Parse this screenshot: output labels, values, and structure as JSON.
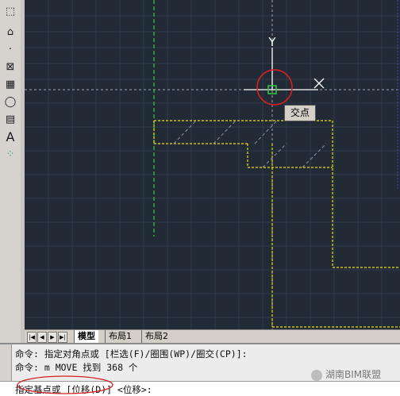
{
  "toolbar": {
    "tools": [
      {
        "icon": "select-icon",
        "glyph": "⬚"
      },
      {
        "icon": "region-icon",
        "glyph": "⌂"
      },
      {
        "icon": "dot-icon",
        "glyph": "·"
      },
      {
        "icon": "hatch-icon",
        "glyph": "⊠"
      },
      {
        "icon": "gradient-icon",
        "glyph": "▦"
      },
      {
        "icon": "revcloud-icon",
        "glyph": "◯"
      },
      {
        "icon": "table-icon",
        "glyph": "▤"
      },
      {
        "icon": "text-icon",
        "glyph": "A"
      },
      {
        "icon": "add-selected-icon",
        "glyph": "⁘"
      }
    ]
  },
  "canvas": {
    "ucs_y_label": "Y",
    "ucs_x_label": "X",
    "osnap_tooltip": "交点",
    "colors": {
      "background": "#222a36",
      "green_line": "#2ecc40",
      "yellow_line": "#f0e000",
      "snap_circle": "#e02020",
      "crosshair": "#ffffff"
    }
  },
  "layout_tabs": {
    "nav": [
      "|◀",
      "◀",
      "▶",
      "▶|"
    ],
    "tabs": [
      "模型",
      "布局1",
      "布局2"
    ],
    "active": "模型"
  },
  "command": {
    "history": [
      "命令: 指定对角点或 [栏选(F)/圈围(WP)/圈交(CP)]:",
      "命令: m MOVE 找到 368 个"
    ],
    "prompt": "指定基点或 [位移(D)] <位移>:"
  },
  "watermark": "湖南BIM联盟"
}
